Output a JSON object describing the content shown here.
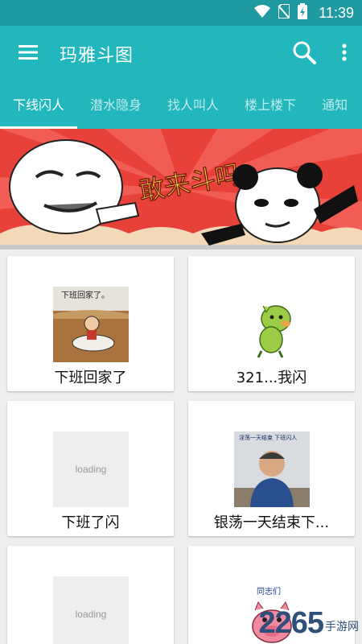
{
  "status_bar": {
    "time": "11:39",
    "icons": [
      "wifi-icon",
      "no-sim-icon",
      "battery-charging-icon"
    ]
  },
  "app_bar": {
    "title": "玛雅斗图",
    "icons": [
      "menu-icon",
      "search-icon",
      "more-vert-icon"
    ]
  },
  "tabs": [
    {
      "label": "下线闪人",
      "active": true
    },
    {
      "label": "潜水隐身",
      "active": false
    },
    {
      "label": "找人叫人",
      "active": false
    },
    {
      "label": "楼上楼下",
      "active": false
    },
    {
      "label": "通知",
      "active": false
    }
  ],
  "banner": {
    "text": "敢来斗吗"
  },
  "cards": [
    {
      "caption": "下班回家了",
      "image_text": "下班回家了。",
      "loading": false
    },
    {
      "caption": "321...我闪",
      "image_text": "",
      "loading": false
    },
    {
      "caption": "下班了闪",
      "image_text": "loading",
      "loading": true
    },
    {
      "caption": "银荡一天结束下...",
      "image_text": "淫荡一天结束 下班闪人",
      "loading": false
    },
    {
      "caption": "",
      "image_text": "loading",
      "loading": true
    },
    {
      "caption": "",
      "image_text": "同志们",
      "loading": false
    }
  ],
  "watermark": {
    "number": "2265",
    "text": "手游网"
  },
  "colors": {
    "primary": "#22b6bd",
    "status_bar": "#1e9aa0",
    "background": "#eeeeee"
  }
}
